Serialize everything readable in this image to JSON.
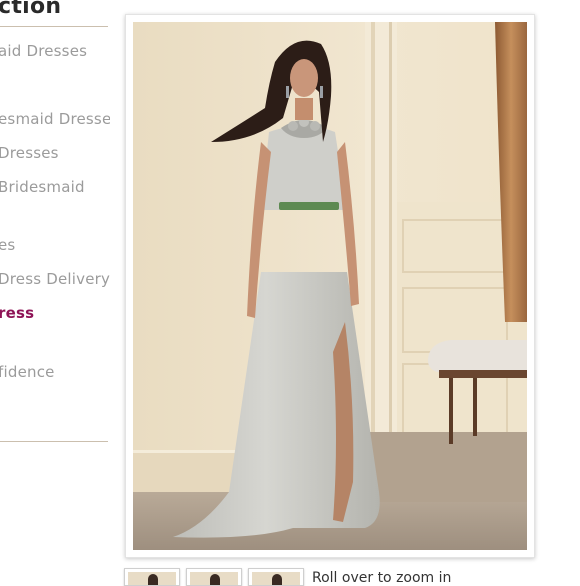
{
  "sidebar": {
    "title": "ction",
    "items": [
      {
        "label": "aid Dresses",
        "active": false
      },
      {
        "label": "esmaid Dresses",
        "active": false
      },
      {
        "label": "Dresses",
        "active": false
      },
      {
        "label": " Bridesmaid",
        "active": false
      },
      {
        "label": "es",
        "active": false
      },
      {
        "label": "Dress Delivery",
        "active": false
      },
      {
        "label": "ress",
        "active": true
      },
      {
        "label": "fidence",
        "active": false
      }
    ]
  },
  "product": {
    "image_alt": "Model wearing a long grey halter bridesmaid dress with green satin sash and thigh slit",
    "thumbnail_count": 3,
    "zoom_hint": "Roll over to zoom in"
  },
  "colors": {
    "accent": "#8e1356",
    "dress": "#c9c9c4",
    "sash": "#5d8a52",
    "wall": "#ede2cc",
    "curtain": "#b5804f"
  }
}
